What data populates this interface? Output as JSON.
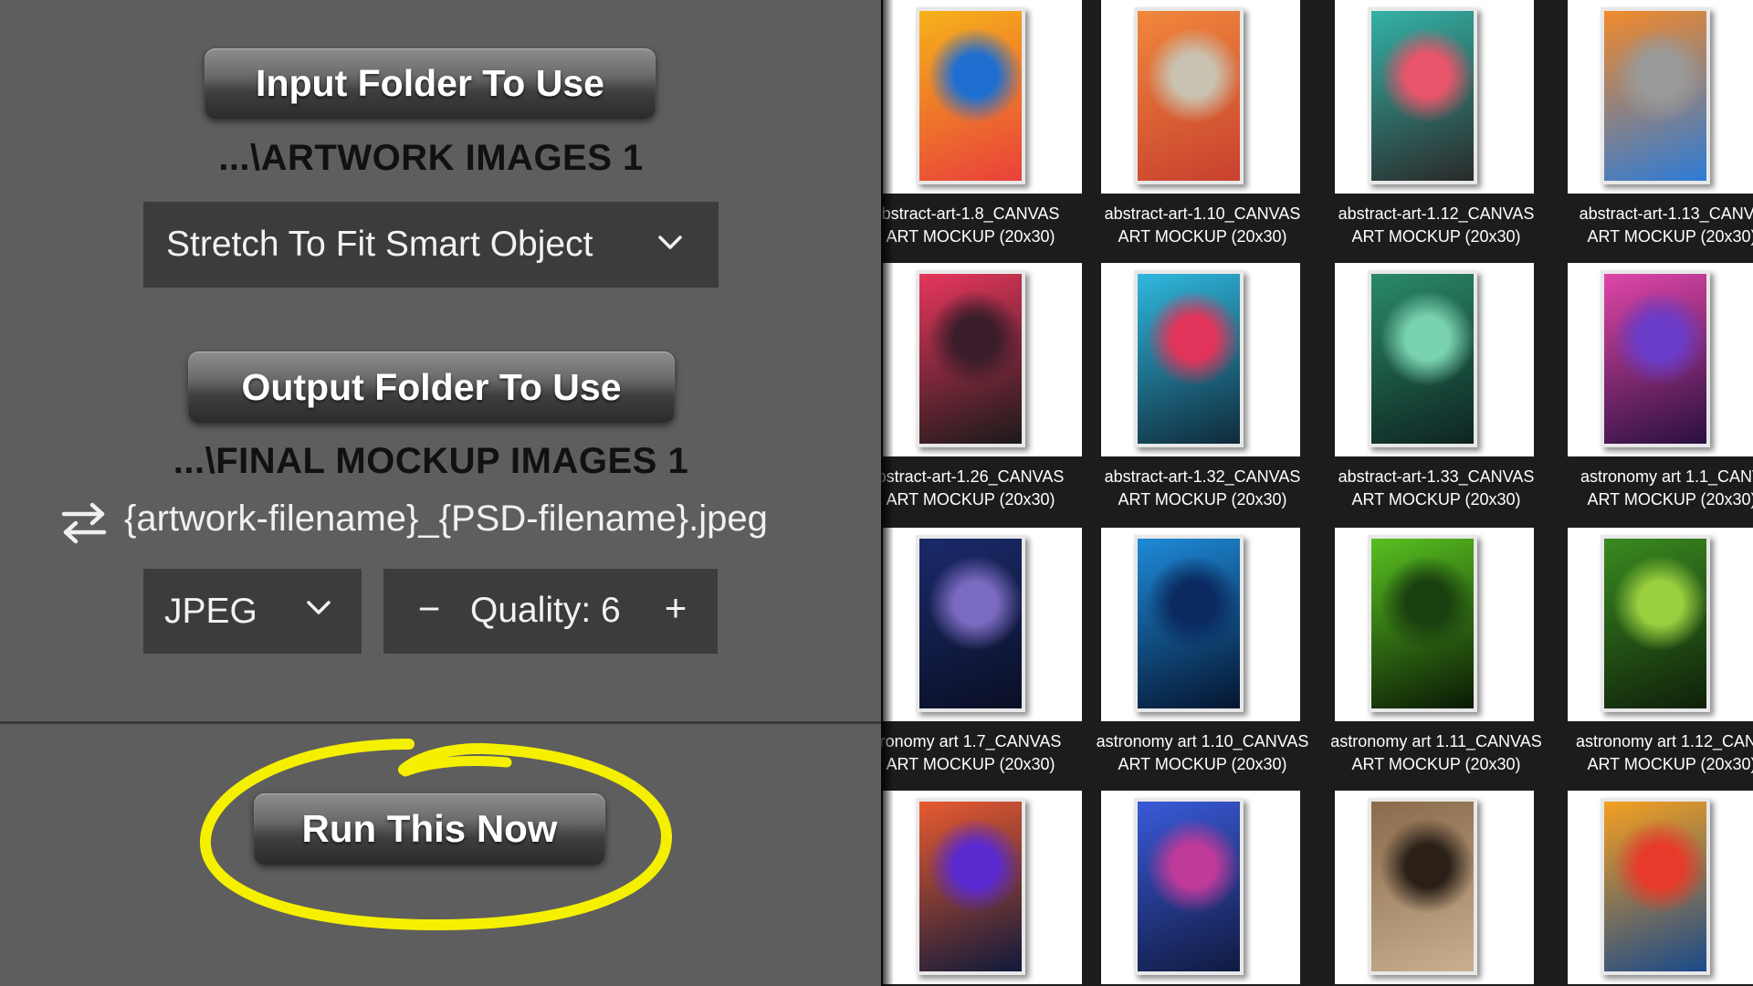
{
  "left_panel": {
    "input_button_label": "Input Folder To Use",
    "input_path": "...\\ARTWORK IMAGES 1",
    "fit_mode": "Stretch To Fit Smart Object",
    "output_button_label": "Output Folder To Use",
    "output_path": "...\\FINAL MOCKUP IMAGES 1",
    "rename_pattern": "{artwork-filename}_{PSD-filename}.jpeg",
    "format": "JPEG",
    "quality_minus": "−",
    "quality_label": "Quality: 6",
    "quality_plus": "+",
    "run_button_label": "Run This Now",
    "icons": [
      "chevron-down-icon",
      "swap-arrows-icon",
      "highlight-circle"
    ],
    "colors": {
      "panel_bg": "#5e5e5e",
      "box_bg": "#3c3c3c",
      "highlight": "#f5f000"
    }
  },
  "file_grid": {
    "items": [
      {
        "line1": "bstract-art-1.8_CANVAS",
        "line2": "ART MOCKUP (20x30)",
        "palette": [
          "#f6b21a",
          "#1f6fd1",
          "#e8413a"
        ]
      },
      {
        "line1": "abstract-art-1.10_CANVAS",
        "line2": "ART MOCKUP (20x30)",
        "palette": [
          "#f0883c",
          "#c9c2b0",
          "#c8402e"
        ]
      },
      {
        "line1": "abstract-art-1.12_CANVAS",
        "line2": "ART MOCKUP (20x30)",
        "palette": [
          "#34b2a6",
          "#e9556a",
          "#2a2a2a"
        ]
      },
      {
        "line1": "abstract-art-1.13_CANVA",
        "line2": "ART MOCKUP (20x30)",
        "palette": [
          "#f28a2b",
          "#9a9a9a",
          "#2d7bd6"
        ]
      },
      {
        "line1": "bstract-art-1.26_CANVAS",
        "line2": "ART MOCKUP (20x30)",
        "palette": [
          "#e7365c",
          "#3a1d2a",
          "#1a1a1a"
        ]
      },
      {
        "line1": "abstract-art-1.32_CANVAS",
        "line2": "ART MOCKUP (20x30)",
        "palette": [
          "#2fb8de",
          "#e2345a",
          "#0f2a3a"
        ]
      },
      {
        "line1": "abstract-art-1.33_CANVAS",
        "line2": "ART MOCKUP (20x30)",
        "palette": [
          "#2a8a6a",
          "#7ad3b0",
          "#0e2420"
        ]
      },
      {
        "line1": "astronomy art 1.1_CANV",
        "line2": "ART MOCKUP (20x30)",
        "palette": [
          "#e046a8",
          "#6a3cc8",
          "#2a1040"
        ]
      },
      {
        "line1": "ronomy art 1.7_CANVAS",
        "line2": "ART MOCKUP (20x30)",
        "palette": [
          "#1a2a6a",
          "#7a6ac0",
          "#0a0f25"
        ]
      },
      {
        "line1": "astronomy art 1.10_CANVAS",
        "line2": "ART MOCKUP (20x30)",
        "palette": [
          "#1e8ad8",
          "#0a2a60",
          "#051530"
        ]
      },
      {
        "line1": "astronomy art 1.11_CANVAS",
        "line2": "ART MOCKUP (20x30)",
        "palette": [
          "#58c020",
          "#1a4010",
          "#0a1a05"
        ]
      },
      {
        "line1": "astronomy art 1.12_CANV",
        "line2": "ART MOCKUP (20x30)",
        "palette": [
          "#3a8a20",
          "#9ad040",
          "#0f200a"
        ]
      },
      {
        "line1": "",
        "line2": "",
        "palette": [
          "#e85a30",
          "#5a2ad0",
          "#101a3a"
        ]
      },
      {
        "line1": "",
        "line2": "",
        "palette": [
          "#3a5ad8",
          "#c03a9a",
          "#101a40"
        ]
      },
      {
        "line1": "",
        "line2": "",
        "palette": [
          "#8a6a4a",
          "#2a2018",
          "#c8b090"
        ]
      },
      {
        "line1": "",
        "line2": "",
        "palette": [
          "#f5a020",
          "#e83a2a",
          "#1a4a8a"
        ]
      }
    ]
  }
}
